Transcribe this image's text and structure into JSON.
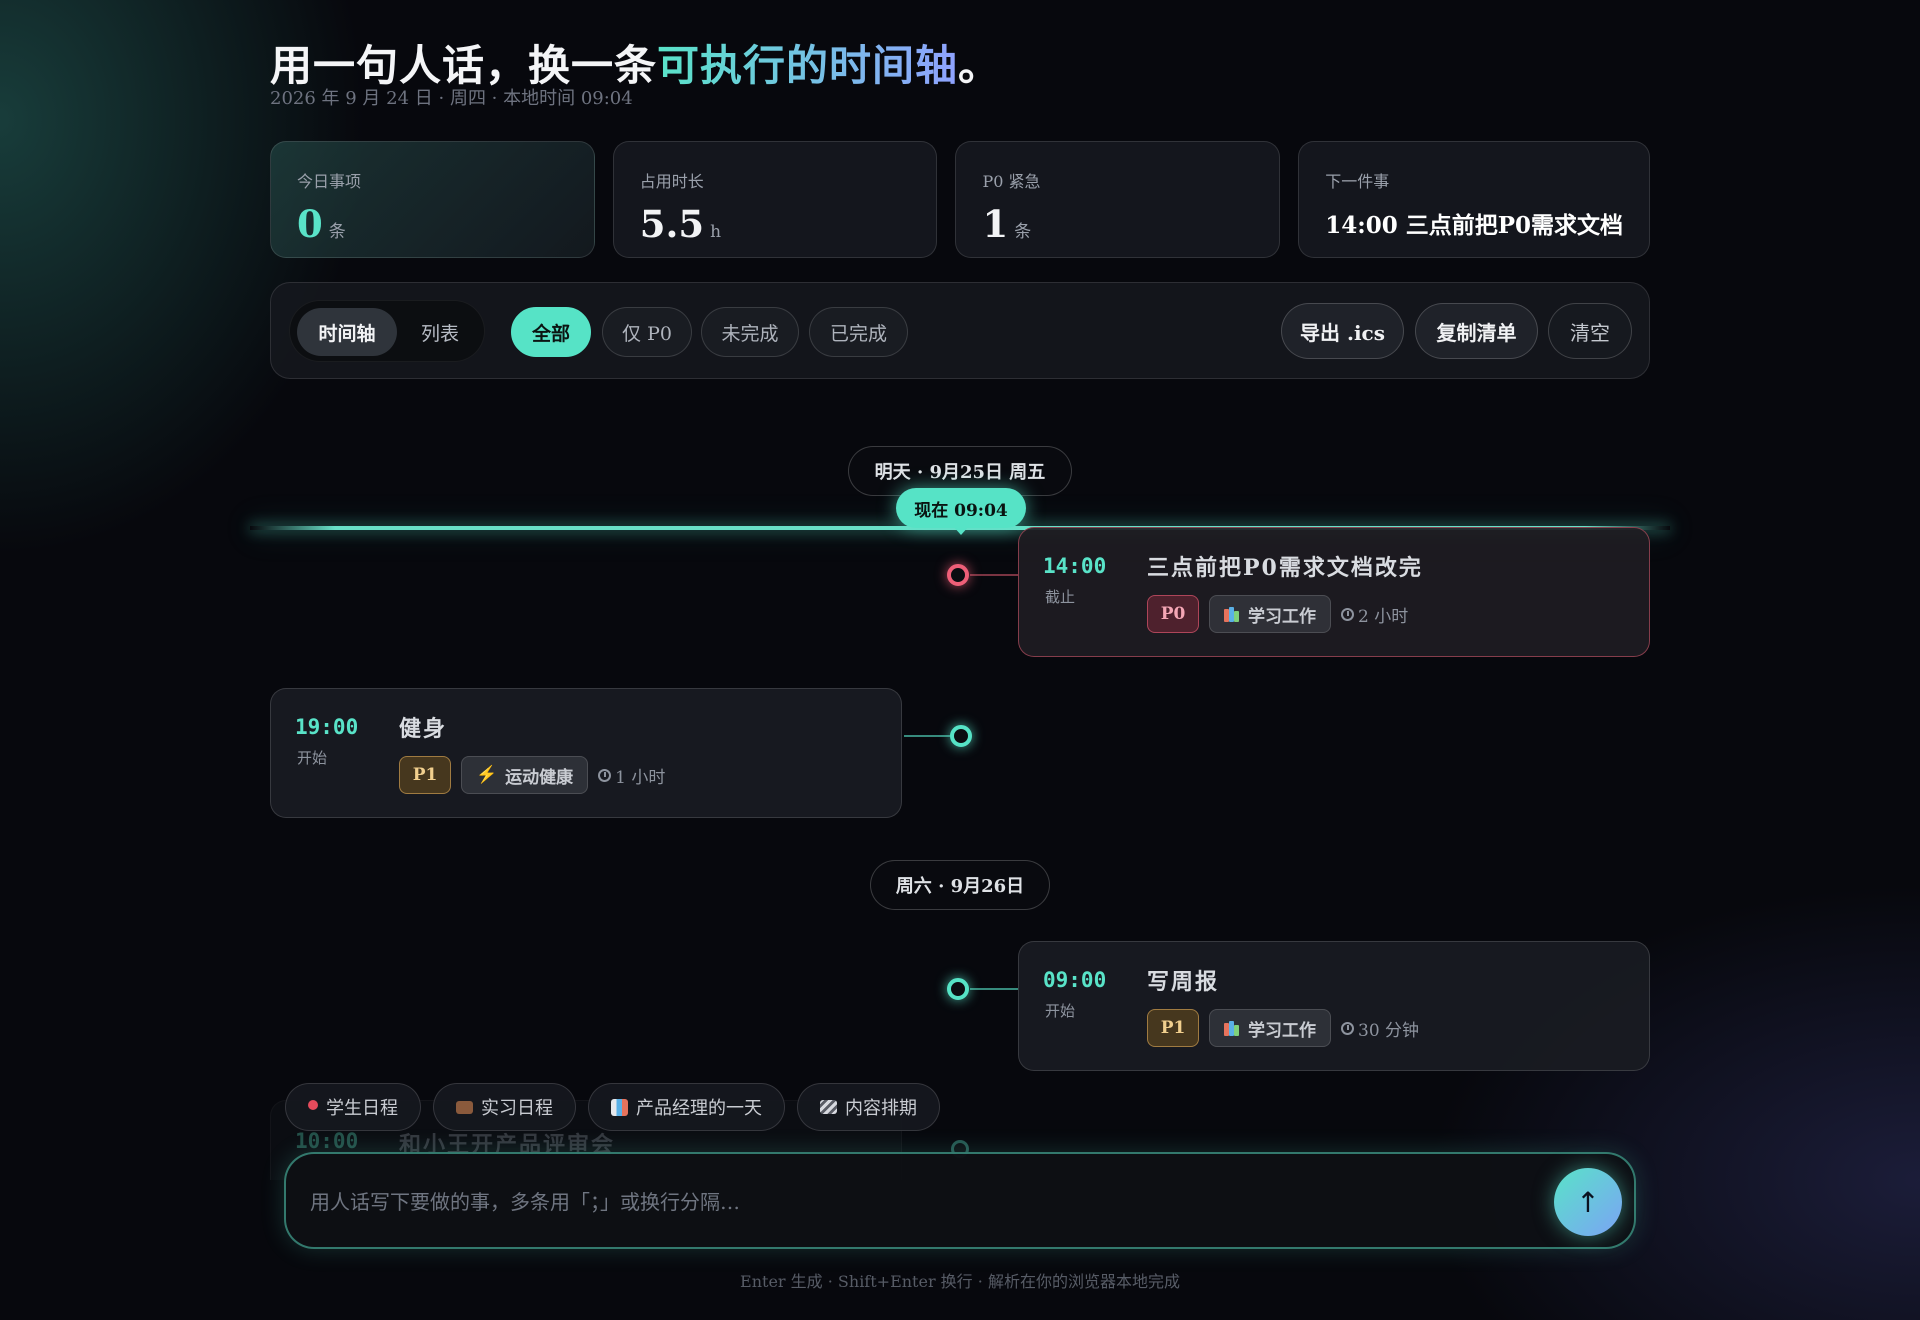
{
  "header": {
    "title_prefix": "用一句人话，换一条",
    "title_highlight": "可执行的时间轴",
    "title_suffix": "。",
    "subtitle": "2026 年 9 月 24 日 · 周四 · 本地时间 09:04"
  },
  "stats": [
    {
      "label": "今日事项",
      "value": "0",
      "unit": "条"
    },
    {
      "label": "占用时长",
      "value": "5.5",
      "unit": "h"
    },
    {
      "label": "P0 紧急",
      "value": "1",
      "unit": "条"
    },
    {
      "label": "下一件事",
      "text": "14:00 三点前把P0需求文档"
    }
  ],
  "toolbar": {
    "view_timeline": "时间轴",
    "view_list": "列表",
    "filters": [
      "全部",
      "仅 P0",
      "未完成",
      "已完成"
    ],
    "active_filter": "全部",
    "export_label": "导出 .ics",
    "copy_label": "复制清单",
    "clear_label": "清空"
  },
  "timeline": {
    "now_label": "现在 09:04",
    "groups": [
      {
        "date_label": "明天 · 9月25日 周五",
        "items": [
          {
            "time": "14:00",
            "time_kind": "截止",
            "title": "三点前把P0需求文档改完",
            "priority": "P0",
            "category": "学习工作",
            "category_icon": "books-icon",
            "duration": "2 小时",
            "side": "right",
            "accent": "#ee5f78"
          },
          {
            "time": "19:00",
            "time_kind": "开始",
            "title": "健身",
            "priority": "P1",
            "category": "运动健康",
            "category_icon": "running-icon",
            "duration": "1 小时",
            "side": "left",
            "accent": "#56e3c6"
          }
        ]
      },
      {
        "date_label": "周六 · 9月26日",
        "items": [
          {
            "time": "09:00",
            "time_kind": "开始",
            "title": "写周报",
            "priority": "P1",
            "category": "学习工作",
            "category_icon": "books-icon",
            "duration": "30 分钟",
            "side": "right",
            "accent": "#56e3c6"
          },
          {
            "time": "10:00",
            "title": "和小王开产品评审会",
            "side": "left"
          }
        ]
      }
    ]
  },
  "presets": [
    {
      "label": "学生日程",
      "icon": "pushpin-icon"
    },
    {
      "label": "实习日程",
      "icon": "briefcase-icon"
    },
    {
      "label": "产品经理的一天",
      "icon": "bar-chart-icon"
    },
    {
      "label": "内容排期",
      "icon": "clapper-icon"
    }
  ],
  "composer": {
    "placeholder": "用人话写下要做的事，多条用「；」或换行分隔…",
    "send_symbol": "↑"
  },
  "footer": "Enter 生成 · Shift+Enter 换行 · 解析在你的浏览器本地完成",
  "colors": {
    "accent": "#56e3c6",
    "accent2": "#8fa2ff",
    "p0": "#ee5f78",
    "p1": "#f1cf8e",
    "background": "#07080d"
  }
}
